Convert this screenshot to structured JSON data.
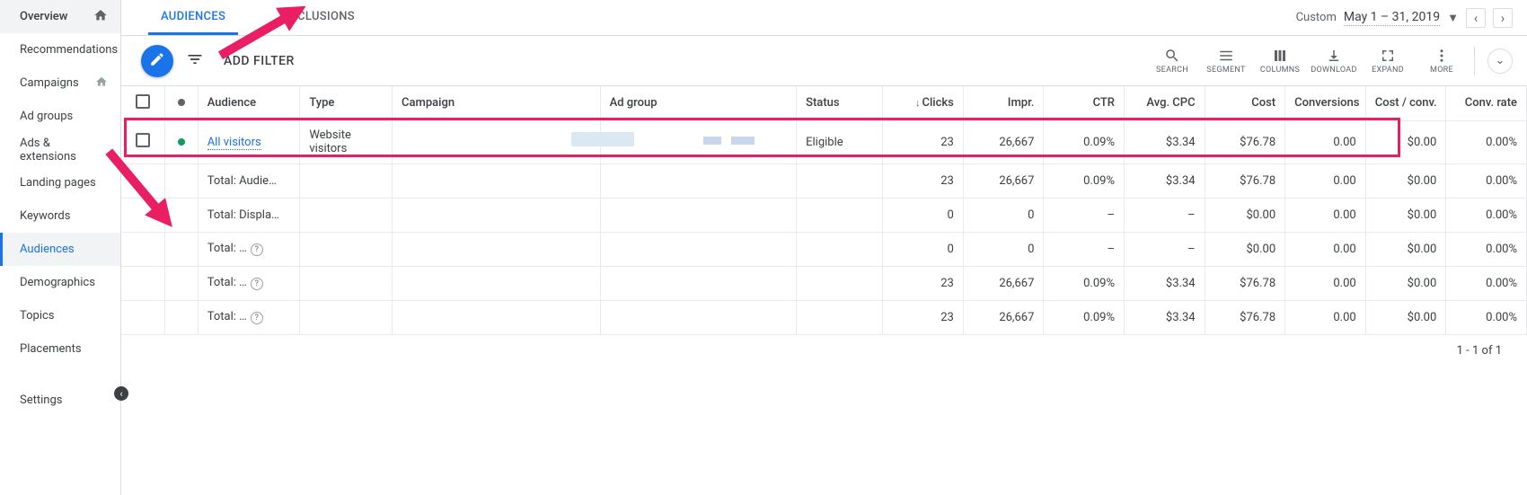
{
  "sidebar": {
    "items": [
      {
        "label": "Overview",
        "icon": true,
        "overview": true
      },
      {
        "label": "Recommendations"
      },
      {
        "label": "Campaigns",
        "icon": true
      },
      {
        "label": "Ad groups"
      },
      {
        "label": "Ads & extensions"
      },
      {
        "label": "Landing pages"
      },
      {
        "label": "Keywords"
      },
      {
        "label": "Audiences",
        "active": true
      },
      {
        "label": "Demographics"
      },
      {
        "label": "Topics"
      },
      {
        "label": "Placements"
      },
      {
        "label": "Settings"
      }
    ]
  },
  "tabs": {
    "audiences": "AUDIENCES",
    "exclusions": "EXCLUSIONS"
  },
  "date": {
    "custom": "Custom",
    "range": "May 1 – 31, 2019"
  },
  "toolbar": {
    "add_filter": "ADD FILTER",
    "search": "SEARCH",
    "segment": "SEGMENT",
    "columns": "COLUMNS",
    "download": "DOWNLOAD",
    "expand": "EXPAND",
    "more": "MORE"
  },
  "columns": {
    "audience": "Audience",
    "type": "Type",
    "campaign": "Campaign",
    "ad_group": "Ad group",
    "status": "Status",
    "clicks": "Clicks",
    "impr": "Impr.",
    "ctr": "CTR",
    "avg_cpc": "Avg. CPC",
    "cost": "Cost",
    "conversions": "Conversions",
    "cost_conv": "Cost / conv.",
    "conv_rate": "Conv. rate"
  },
  "rows": {
    "r0": {
      "audience": "All visitors",
      "type": "Website visitors",
      "status": "Eligible",
      "clicks": "23",
      "impr": "26,667",
      "ctr": "0.09%",
      "cpc": "$3.34",
      "cost": "$76.78",
      "conv": "0.00",
      "cpconv": "$0.00",
      "rate": "0.00%"
    },
    "t1": {
      "label": "Total: Audie…",
      "clicks": "23",
      "impr": "26,667",
      "ctr": "0.09%",
      "cpc": "$3.34",
      "cost": "$76.78",
      "conv": "0.00",
      "cpconv": "$0.00",
      "rate": "0.00%"
    },
    "t2": {
      "label": "Total: Displa…",
      "clicks": "0",
      "impr": "0",
      "ctr": "–",
      "cpc": "–",
      "cost": "$0.00",
      "conv": "0.00",
      "cpconv": "$0.00",
      "rate": "0.00%"
    },
    "t3": {
      "label": "Total: …",
      "clicks": "0",
      "impr": "0",
      "ctr": "–",
      "cpc": "–",
      "cost": "$0.00",
      "conv": "0.00",
      "cpconv": "$0.00",
      "rate": "0.00%"
    },
    "t4": {
      "label": "Total: …",
      "clicks": "23",
      "impr": "26,667",
      "ctr": "0.09%",
      "cpc": "$3.34",
      "cost": "$76.78",
      "conv": "0.00",
      "cpconv": "$0.00",
      "rate": "0.00%"
    },
    "t5": {
      "label": "Total: …",
      "clicks": "23",
      "impr": "26,667",
      "ctr": "0.09%",
      "cpc": "$3.34",
      "cost": "$76.78",
      "conv": "0.00",
      "cpconv": "$0.00",
      "rate": "0.00%"
    }
  },
  "footer": "1 - 1 of 1"
}
